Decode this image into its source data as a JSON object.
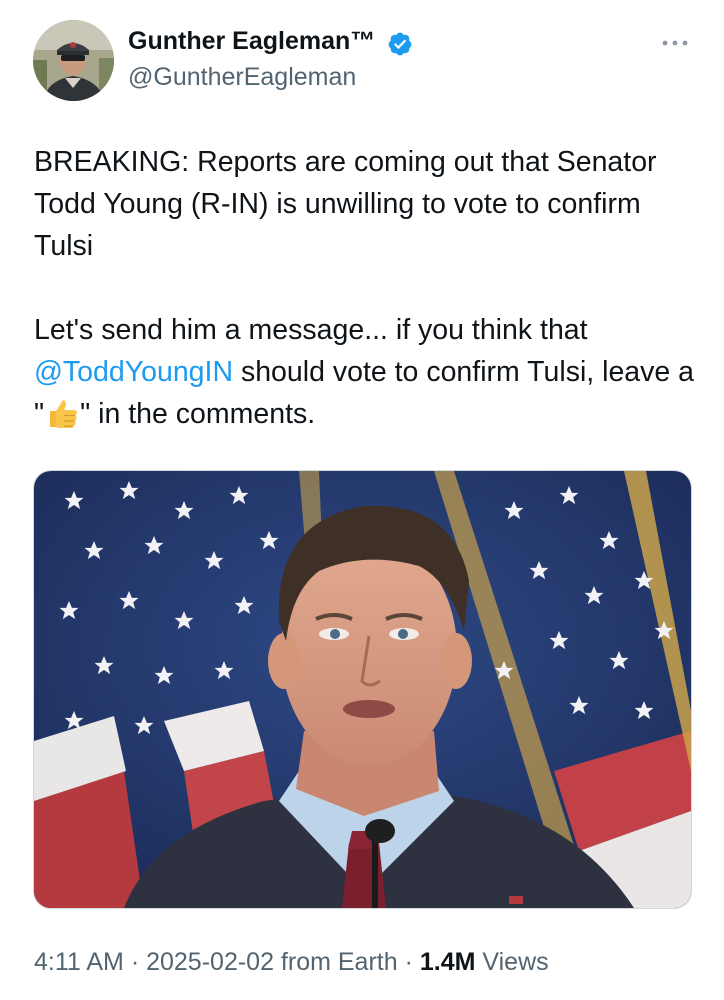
{
  "author": {
    "display_name": "Gunther Eagleman™",
    "handle": "@GuntherEagleman",
    "verified": true
  },
  "tweet": {
    "line1": "BREAKING: Reports are coming out that Senator Todd Young (R-IN) is unwilling to vote to confirm Tulsi",
    "line2_before": "Let's send him a message... if you think that",
    "mention": "@ToddYoungIN",
    "line2_after": " should vote to confirm Tulsi, leave a \"",
    "emoji": "thumbs-up",
    "line2_end": "\" in the comments."
  },
  "meta": {
    "time": "4:11 AM",
    "dot1": " · ",
    "date": "2025-02-02",
    "source": " from Earth",
    "dot2": " · ",
    "views_count": "1.4M",
    "views_label": " Views"
  },
  "colors": {
    "link": "#1d9bf0",
    "secondary_text": "#536471",
    "primary_text": "#0f1419",
    "verified_badge": "#1d9bf0"
  },
  "icons": [
    "avatar",
    "verified-badge-icon",
    "more-options-icon",
    "thumbs-up-emoji"
  ]
}
